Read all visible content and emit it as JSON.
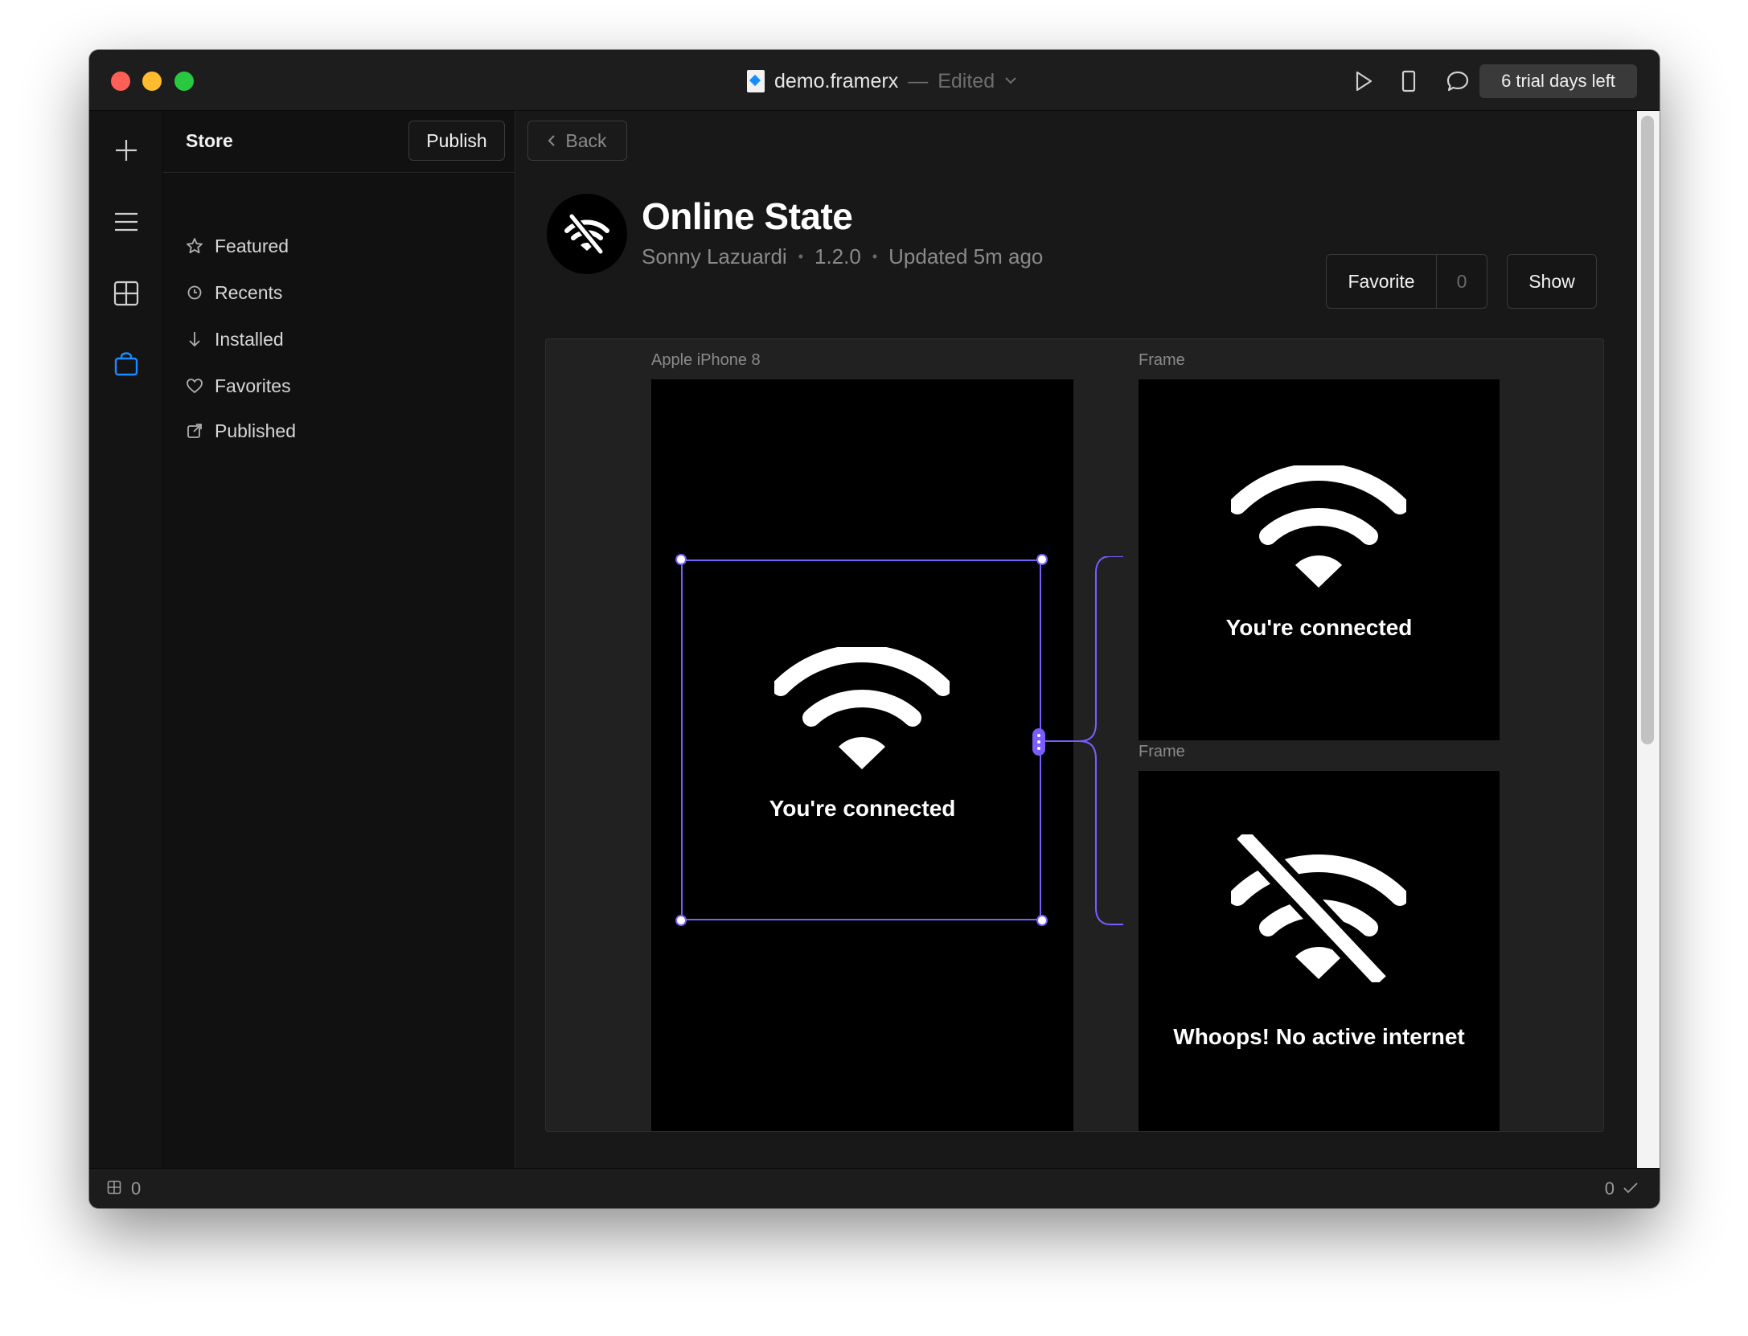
{
  "titlebar": {
    "doc_name": "demo.framerx",
    "separator": "—",
    "status": "Edited",
    "trial_label": "6 trial days left"
  },
  "sidebar": {
    "title": "Store",
    "publish_label": "Publish",
    "items": [
      {
        "label": "Featured",
        "icon": "star-icon"
      },
      {
        "label": "Recents",
        "icon": "clock-icon"
      },
      {
        "label": "Installed",
        "icon": "download-arrow-icon"
      },
      {
        "label": "Favorites",
        "icon": "heart-icon"
      },
      {
        "label": "Published",
        "icon": "external-link-icon"
      }
    ]
  },
  "main": {
    "back_label": "Back",
    "package": {
      "name": "Online State",
      "author": "Sonny Lazuardi",
      "version": "1.2.0",
      "updated": "Updated 5m ago",
      "favorite_label": "Favorite",
      "favorite_count": "0",
      "show_label": "Show"
    },
    "canvas": {
      "device_label": "Apple iPhone 8",
      "device_text": "You're connected",
      "frames": [
        {
          "label": "Frame",
          "text": "You're connected",
          "icon": "wifi-icon"
        },
        {
          "label": "Frame",
          "text": "Whoops! No active internet",
          "icon": "wifi-off-icon"
        }
      ]
    }
  },
  "statusbar": {
    "left_count": "0",
    "right_count": "0"
  },
  "colors": {
    "accent": "#7b5cff",
    "rail_active": "#1a8cff"
  }
}
